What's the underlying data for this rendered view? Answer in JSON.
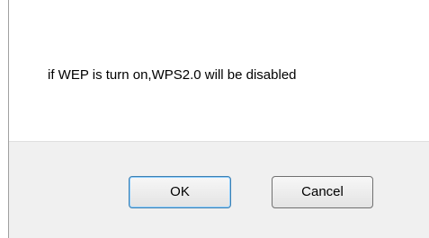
{
  "dialog": {
    "message": "if WEP is turn on,WPS2.0 will be disabled",
    "ok_label": "OK",
    "cancel_label": "Cancel"
  }
}
